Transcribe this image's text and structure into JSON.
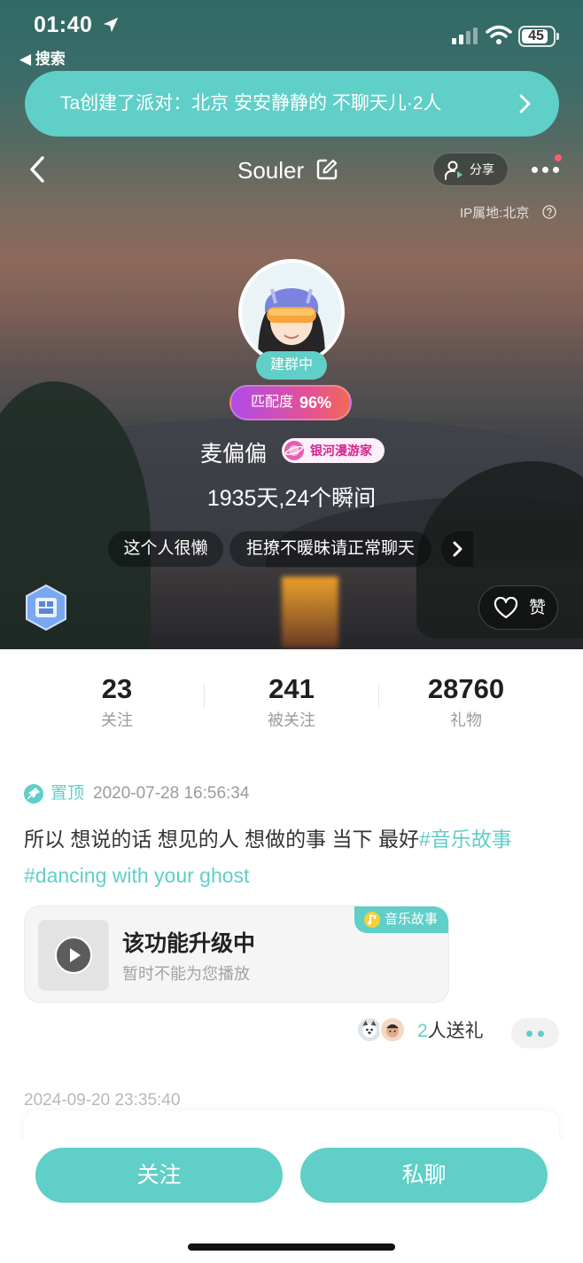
{
  "status_bar": {
    "time": "01:40",
    "back_app": "◀ 搜索",
    "battery": "45"
  },
  "party_banner": {
    "text": "Ta创建了派对：北京 安安静静的 不聊天儿·2人"
  },
  "nav": {
    "title": "Souler",
    "share_label": "分享",
    "ip_location": "IP属地:北京"
  },
  "profile": {
    "group_tag": "建群中",
    "match_label": "匹配度",
    "match_value": "96%",
    "nickname": "麦偏偏",
    "badge": "银河漫游家",
    "stats_line": "1935天,24个瞬间",
    "tags": [
      "这个人很懒",
      "拒撩不暖昧请正常聊天"
    ],
    "like_label": "赞"
  },
  "counts": [
    {
      "value": "23",
      "label": "关注"
    },
    {
      "value": "241",
      "label": "被关注"
    },
    {
      "value": "28760",
      "label": "礼物"
    }
  ],
  "post": {
    "pin_label": "置顶",
    "time": "2020-07-28 16:56:34",
    "text_plain": "所以 想说的话 想见的人 想做的事 当下 最好",
    "text_tag1": "#音乐故事",
    "text_tag2": " #dancing with your ghost",
    "music": {
      "title": "该功能升级中",
      "subtitle": "暂时不能为您播放",
      "tag": "音乐故事"
    },
    "gift_count": "2",
    "gift_suffix": "人送礼"
  },
  "post2": {
    "time": "2024-09-20 23:35:40"
  },
  "actions": {
    "follow": "关注",
    "chat": "私聊"
  },
  "colors": {
    "accent": "#5fcfc7",
    "match_gradient": [
      "#b04be8",
      "#f06a55"
    ],
    "badge_text": "#d6258f"
  }
}
